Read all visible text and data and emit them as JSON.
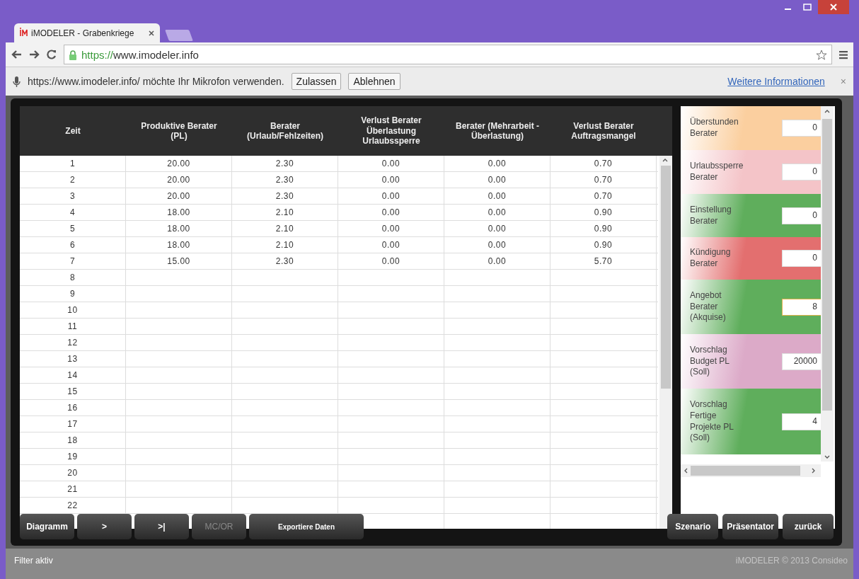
{
  "browser": {
    "tabs": [
      {
        "title": "iMODELER - Grabenkriege",
        "selected": true
      }
    ],
    "address": {
      "scheme": "https://",
      "host": "www.imodeler.info"
    },
    "infobar": {
      "message": "https://www.imodeler.info/ möchte Ihr Mikrofon verwenden.",
      "buttons": [
        "Zulassen",
        "Ablehnen"
      ],
      "link": "Weitere Informationen",
      "close": "×"
    }
  },
  "table": {
    "columns": [
      "Zeit",
      "Produktive Berater\n(PL)",
      "Berater\n(Urlaub/Fehlzeiten)",
      "Verlust Berater\nÜberlastung\nUrlaubssperre",
      "Berater (Mehrarbeit -\nÜberlastung)",
      "Verlust Berater\nAuftragsmangel"
    ],
    "rows": [
      [
        "1",
        "20.00",
        "2.30",
        "0.00",
        "0.00",
        "0.70"
      ],
      [
        "2",
        "20.00",
        "2.30",
        "0.00",
        "0.00",
        "0.70"
      ],
      [
        "3",
        "20.00",
        "2.30",
        "0.00",
        "0.00",
        "0.70"
      ],
      [
        "4",
        "18.00",
        "2.10",
        "0.00",
        "0.00",
        "0.90"
      ],
      [
        "5",
        "18.00",
        "2.10",
        "0.00",
        "0.00",
        "0.90"
      ],
      [
        "6",
        "18.00",
        "2.10",
        "0.00",
        "0.00",
        "0.90"
      ],
      [
        "7",
        "15.00",
        "2.30",
        "0.00",
        "0.00",
        "5.70"
      ],
      [
        "8"
      ],
      [
        "9"
      ],
      [
        "10"
      ],
      [
        "11"
      ],
      [
        "12"
      ],
      [
        "13"
      ],
      [
        "14"
      ],
      [
        "15"
      ],
      [
        "16"
      ],
      [
        "17"
      ],
      [
        "18"
      ],
      [
        "19"
      ],
      [
        "20"
      ],
      [
        "21"
      ],
      [
        "22"
      ]
    ]
  },
  "parameters": [
    {
      "label": "Überstunden\nBerater",
      "value": "0",
      "color": "#fbcf9f",
      "focused": false
    },
    {
      "label": "Urlaubssperre\nBerater",
      "value": "0",
      "color": "#f4c4c8",
      "focused": false
    },
    {
      "label": "Einstellung\nBerater",
      "value": "0",
      "color": "#5fae5c",
      "focused": false
    },
    {
      "label": "Kündigung\nBerater",
      "value": "0",
      "color": "#e36f6f",
      "focused": false
    },
    {
      "label": "Angebot\nBerater\n(Akquise)",
      "value": "8",
      "color": "#5fae5c",
      "focused": true
    },
    {
      "label": "Vorschlag\nBudget PL\n(Soll)",
      "value": "20000",
      "color": "#dcaac8",
      "focused": false
    },
    {
      "label": "Vorschlag\nFertige\nProjekte PL\n(Soll)",
      "value": "4",
      "color": "#5fae5c",
      "focused": false
    }
  ],
  "left_buttons": [
    {
      "label": "Diagramm",
      "disabled": false
    },
    {
      "label": ">",
      "disabled": false
    },
    {
      "label": ">|",
      "disabled": false
    },
    {
      "label": "MC/OR",
      "disabled": true
    },
    {
      "label": "Exportiere Daten",
      "disabled": false
    }
  ],
  "right_buttons": [
    {
      "label": "Szenario",
      "disabled": false
    },
    {
      "label": "Präsentator",
      "disabled": false
    },
    {
      "label": "zurück",
      "disabled": false
    }
  ],
  "status_bar": {
    "filter": "Filter aktiv",
    "copyright": "iMODELER © 2013 Consideo"
  }
}
